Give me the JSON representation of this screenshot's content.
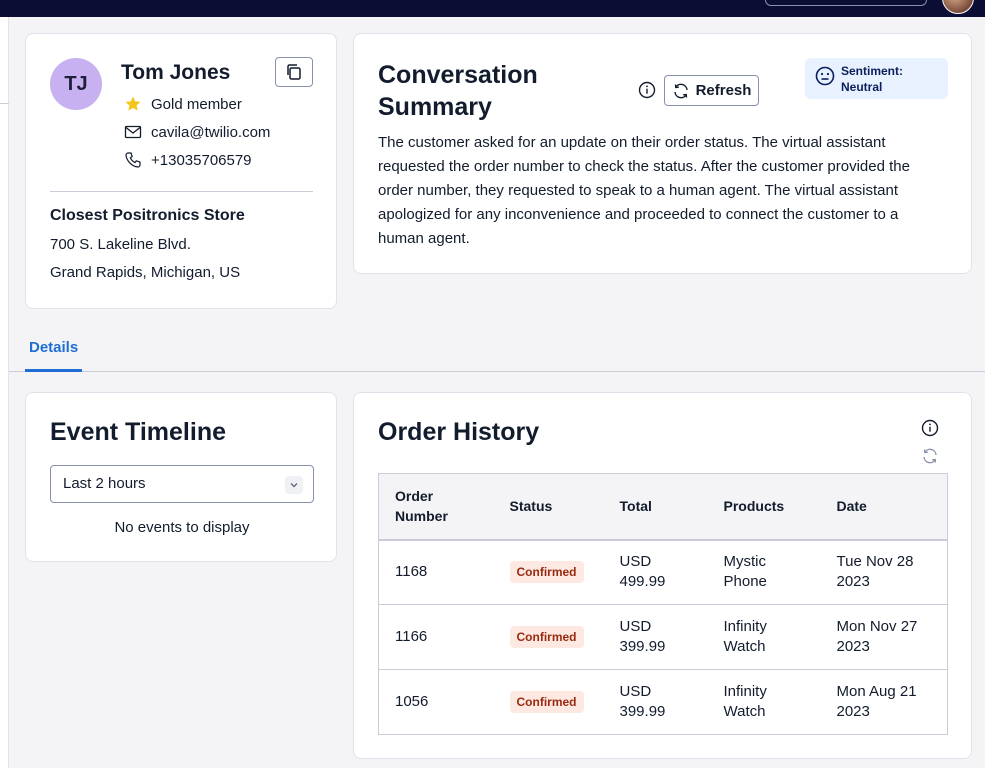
{
  "customer": {
    "initials": "TJ",
    "name": "Tom Jones",
    "tier": "Gold member",
    "email": "cavila@twilio.com",
    "phone": "+13035706579",
    "store_title": "Closest Positronics Store",
    "store_address1": "700 S. Lakeline Blvd.",
    "store_address2": "Grand Rapids, Michigan, US"
  },
  "summary": {
    "title": "Conversation Summary",
    "refresh_label": "Refresh",
    "sentiment_label": "Sentiment:",
    "sentiment_value": "Neutral",
    "body": "The customer asked for an update on their order status. The virtual assistant requested the order number to check the status. After the customer provided the order number, they requested to speak to a human agent. The virtual assistant apologized for any inconvenience and proceeded to connect the customer to a human agent."
  },
  "tabs": [
    {
      "label": "Details",
      "active": true
    }
  ],
  "timeline": {
    "title": "Event Timeline",
    "range_selected": "Last 2 hours",
    "empty_text": "No events to display"
  },
  "orders": {
    "title": "Order History",
    "columns": [
      "Order Number",
      "Status",
      "Total",
      "Products",
      "Date"
    ],
    "rows": [
      {
        "number": "1168",
        "status": "Confirmed",
        "total": "USD 499.99",
        "product": "Mystic Phone",
        "date": "Tue Nov 28 2023"
      },
      {
        "number": "1166",
        "status": "Confirmed",
        "total": "USD 399.99",
        "product": "Infinity Watch",
        "date": "Mon Nov 27 2023"
      },
      {
        "number": "1056",
        "status": "Confirmed",
        "total": "USD 399.99",
        "product": "Infinity Watch",
        "date": "Mon Aug 21 2023"
      }
    ]
  },
  "colors": {
    "accent": "#1f6ed4",
    "topbar": "#0b0d35",
    "avatar_bg": "#c8b1f0",
    "badge_bg": "#fde9e2",
    "badge_text": "#9a2a0f",
    "sentiment_bg": "#e7f1ff"
  },
  "icons": [
    "copy-icon",
    "star-icon",
    "mail-icon",
    "phone-icon",
    "info-icon",
    "refresh-icon",
    "neutral-face-icon",
    "chevron-down-icon"
  ]
}
